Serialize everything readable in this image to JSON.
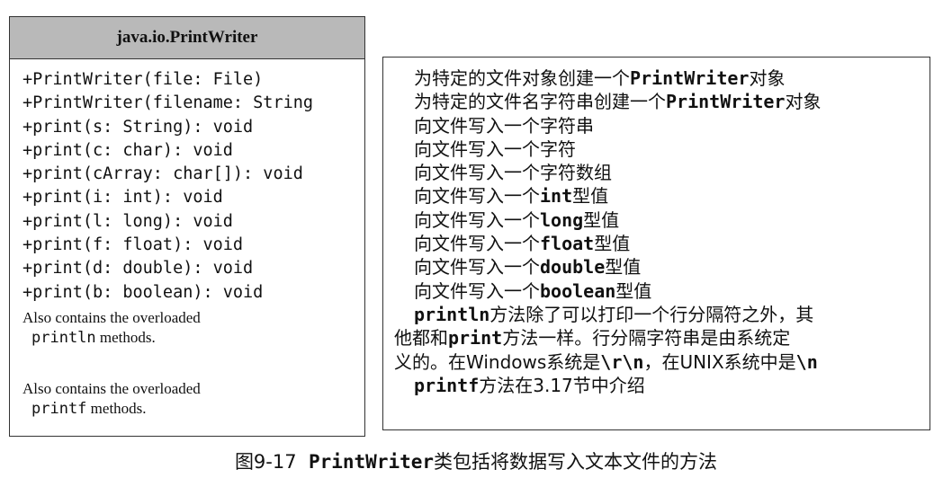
{
  "uml": {
    "class_name": "java.io.PrintWriter",
    "methods": [
      "+PrintWriter(file: File)",
      "+PrintWriter(filename: String",
      "+print(s: String): void",
      "+print(c: char): void",
      "+print(cArray: char[]): void",
      "+print(i: int): void",
      "+print(l: long): void",
      "+print(f: float): void",
      "+print(d: double): void",
      "+print(b: boolean): void"
    ],
    "note_println": {
      "line1": "Also contains the overloaded",
      "code": "println",
      "rest": " methods."
    },
    "note_printf": {
      "line1": "Also contains the overloaded",
      "code": "printf",
      "rest": " methods."
    }
  },
  "descriptions": {
    "lines": [
      [
        "为特定的文件对象创建一个",
        "PrintWriter",
        "对象"
      ],
      [
        "为特定的文件名字符串创建一个",
        "PrintWriter",
        "对象"
      ],
      [
        "向文件写入一个字符串",
        "",
        ""
      ],
      [
        "向文件写入一个字符",
        "",
        ""
      ],
      [
        "向文件写入一个字符数组",
        "",
        ""
      ],
      [
        "向文件写入一个",
        "int",
        "型值"
      ],
      [
        "向文件写入一个",
        "long",
        "型值"
      ],
      [
        "向文件写入一个",
        "float",
        "型值"
      ],
      [
        "向文件写入一个",
        "double",
        "型值"
      ],
      [
        "向文件写入一个",
        "boolean",
        "型值"
      ]
    ],
    "println_para": {
      "l1_code": "println",
      "l1_text": "方法除了可以打印一个行分隔符之外，其",
      "l2_a": "他都和",
      "l2_code": "print",
      "l2_b": "方法一样。行分隔字符串是由系统定",
      "l3_a": "义的。在Windows系统是",
      "l3_code1": "\\r\\n",
      "l3_b": "，在UNIX系统中是",
      "l3_code2": "\\n"
    },
    "printf_para": {
      "code": "printf",
      "text": "方法在3.17节中介绍"
    }
  },
  "caption": {
    "number": "图9-17",
    "class_code": "PrintWriter",
    "text": "类包括将数据写入文本文件的方法"
  }
}
